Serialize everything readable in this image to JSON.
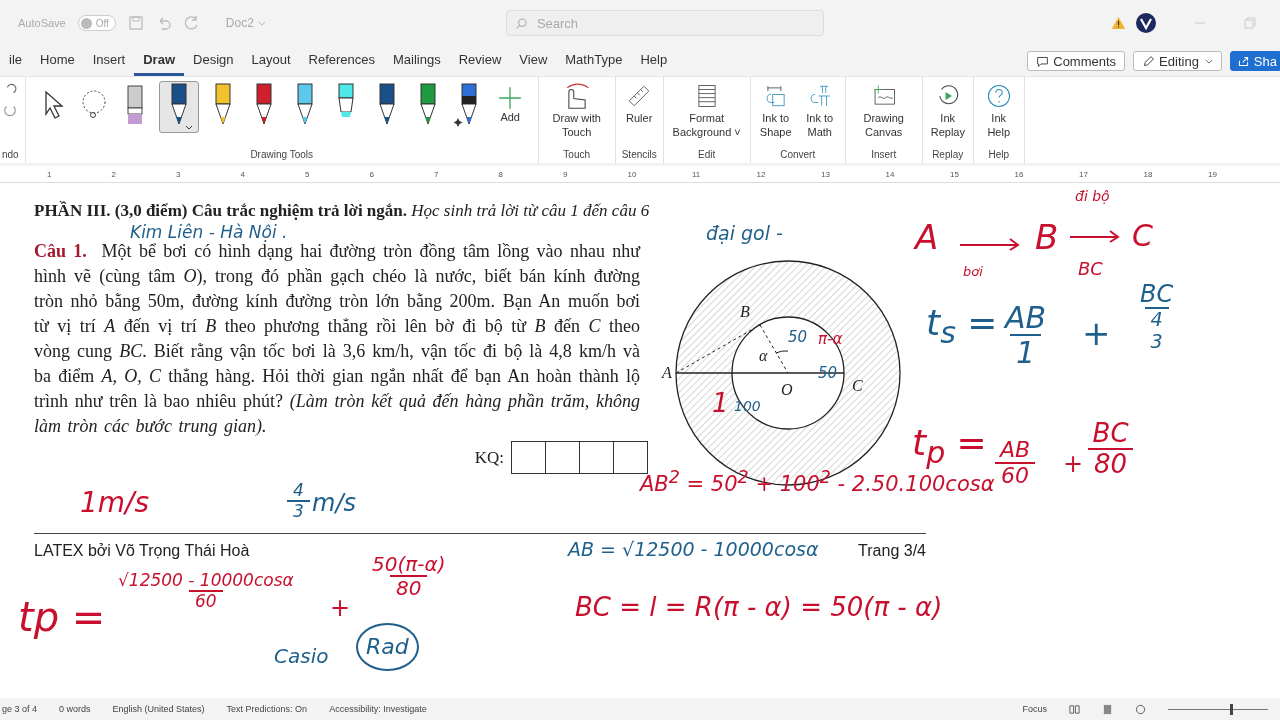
{
  "title_bar": {
    "autosave": "AutoSave",
    "autosave_toggle": {
      "label": "Off",
      "on": false
    },
    "document": "Doc2",
    "search": {
      "placeholder": "Search"
    }
  },
  "tabs": [
    {
      "label": "ile",
      "selected": false
    },
    {
      "label": "Home",
      "selected": false
    },
    {
      "label": "Insert",
      "selected": false
    },
    {
      "label": "Draw",
      "selected": true
    },
    {
      "label": "Design",
      "selected": false
    },
    {
      "label": "Layout",
      "selected": false
    },
    {
      "label": "References",
      "selected": false
    },
    {
      "label": "Mailings",
      "selected": false
    },
    {
      "label": "Review",
      "selected": false
    },
    {
      "label": "View",
      "selected": false
    },
    {
      "label": "MathType",
      "selected": false
    },
    {
      "label": "Help",
      "selected": false
    }
  ],
  "header_buttons": [
    {
      "kind": "comments",
      "label": "Comments"
    },
    {
      "kind": "editing",
      "label": "Editing"
    },
    {
      "kind": "share",
      "label": "Sha"
    }
  ],
  "ribbon": {
    "undo_group": "ndo",
    "tools": [
      {
        "kind": "select",
        "selected": false
      },
      {
        "kind": "lasso",
        "selected": false
      },
      {
        "kind": "eraser",
        "color": "#c39bd3",
        "selected": false
      },
      {
        "kind": "pen",
        "color": "#1b4f8a",
        "selected": true
      },
      {
        "kind": "pencil",
        "color": "#f2c12e",
        "selected": false
      },
      {
        "kind": "pen",
        "color": "#d0202e",
        "selected": false
      },
      {
        "kind": "pencil",
        "color": "#5bc8ec",
        "selected": false
      },
      {
        "kind": "highlighter",
        "color": "#4ee8e8",
        "selected": false
      },
      {
        "kind": "fountain",
        "color": "#1b4f8a",
        "selected": false
      },
      {
        "kind": "pen",
        "color": "#1e9b40",
        "selected": false
      },
      {
        "kind": "action",
        "color": "#2c6fd6",
        "selected": false
      }
    ],
    "add": "Add",
    "tools_group": "Drawing Tools",
    "groups": [
      {
        "label": "Touch",
        "buttons": [
          {
            "kind": "touch",
            "label": "Draw with Touch"
          }
        ]
      },
      {
        "label": "Stencils",
        "buttons": [
          {
            "kind": "ruler",
            "label": "Ruler"
          }
        ]
      },
      {
        "label": "Edit",
        "buttons": [
          {
            "kind": "background",
            "label": "Format Background ˅"
          }
        ]
      },
      {
        "label": "Convert",
        "buttons": [
          {
            "kind": "shape",
            "label": "Ink to Shape"
          },
          {
            "kind": "math",
            "label": "Ink to Math"
          }
        ]
      },
      {
        "label": "Insert",
        "buttons": [
          {
            "kind": "canvas",
            "label": "Drawing Canvas"
          }
        ]
      },
      {
        "label": "Replay",
        "buttons": [
          {
            "kind": "replay",
            "label": "Ink Replay"
          }
        ]
      },
      {
        "label": "Help",
        "buttons": [
          {
            "kind": "help",
            "label": "Ink Help"
          }
        ]
      }
    ]
  },
  "ruler": [
    "1",
    "2",
    "3",
    "4",
    "5",
    "6",
    "7",
    "8",
    "9",
    "10",
    "11",
    "12",
    "13",
    "14",
    "15",
    "16",
    "17",
    "18",
    "19"
  ],
  "document": {
    "heading": "**PHẦN III. (3,0 điểm) Câu trắc nghiệm trả lời ngắn.** *Học sinh trả lời từ câu 1 đến câu 6*",
    "question_label": "Câu 1.",
    "question": "Một bể bơi có hình dạng hai đường tròn đồng tâm lồng vào nhau như hình vẽ (cùng tâm *O*), trong đó phần gạch chéo là nước, biết bán kính đường tròn nhỏ bằng 50m, đường kính đường tròn lớn bằng 200m. Bạn An muốn bơi từ vị trí *A* đến vị trí *B* theo phương thẳng rồi lên bờ đi bộ từ *B* đến *C* theo vòng cung *BC*. Biết rằng vận tốc bơi là 3,6 km/h, vận tốc đi bộ là 4,8 km/h và ba điểm *A, O, C* thẳng hàng. Hỏi thời gian ngắn nhất để bạn An hoàn thành lộ trình như trên là bao nhiêu phút? *(Làm tròn kết quả đến hàng phần trăm, không làm tròn các bước trung gian).*",
    "answer_label": "KQ:",
    "figure_labels": [
      "B",
      "α",
      "A",
      "C",
      "O"
    ],
    "footer_left": "LATEX bởi Võ Trọng Thái Hoà",
    "footer_right": "Trang 3/4"
  },
  "ink": [
    {
      "kind": "text",
      "text": "Kim Liên - Hà Nội .",
      "color": "#1f5f8b"
    },
    {
      "kind": "text",
      "text": "đại gol -",
      "color": "#1f5f8b"
    },
    {
      "kind": "text",
      "text": "A",
      "color": "#c8102e"
    },
    {
      "kind": "text",
      "text": "B",
      "color": "#c8102e"
    },
    {
      "kind": "text",
      "text": "C",
      "color": "#c8102e"
    },
    {
      "kind": "text",
      "text": "bơi",
      "color": "#c8102e"
    },
    {
      "kind": "text",
      "text": "đi bộ",
      "color": "#c8102e"
    },
    {
      "kind": "text",
      "text": "BC",
      "color": "#c8102e"
    },
    {
      "kind": "text",
      "text": "t$_{s}$ =",
      "color": "#1f5f8b"
    },
    {
      "kind": "fraction",
      "num": "AB",
      "den": "1",
      "color": "#1f5f8b"
    },
    {
      "kind": "text",
      "text": "+",
      "color": "#1f5f8b"
    },
    {
      "kind": "fraction",
      "num": "BC",
      "den": {
        "num": "4",
        "den": "3"
      },
      "color": "#1f5f8b"
    },
    {
      "kind": "text",
      "text": "t$_{p}$ =",
      "color": "#c8102e"
    },
    {
      "kind": "fraction",
      "num": "AB",
      "den": "60",
      "color": "#c8102e"
    },
    {
      "kind": "text",
      "text": "+",
      "color": "#c8102e"
    },
    {
      "kind": "fraction",
      "num": "BC",
      "den": "80",
      "color": "#c8102e"
    },
    {
      "kind": "text",
      "text": "AB$^{2}$ = 50$^{2}$ + 100$^{2}$ - 2.50.100cosα",
      "color": "#c8102e"
    },
    {
      "kind": "text",
      "text": "1m/s",
      "color": "#c8102e"
    },
    {
      "kind": "fraction",
      "num": "4",
      "den": "3",
      "color": "#1f5f8b"
    },
    {
      "kind": "text",
      "text": "m/s",
      "color": "#1f5f8b"
    },
    {
      "kind": "text",
      "text": "50",
      "color": "#1f5f8b"
    },
    {
      "kind": "text",
      "text": "π-α",
      "color": "#c8102e"
    },
    {
      "kind": "text",
      "text": "50",
      "color": "#1f5f8b"
    },
    {
      "kind": "text",
      "text": "1",
      "color": "#c8102e"
    },
    {
      "kind": "text",
      "text": "100",
      "color": "#1f5f8b"
    },
    {
      "kind": "text",
      "text": "tp =",
      "color": "#c8102e"
    },
    {
      "kind": "fraction",
      "num": "√12500 - 10000cosα",
      "den": "60",
      "color": "#c8102e"
    },
    {
      "kind": "text",
      "text": "+",
      "color": "#c8102e"
    },
    {
      "kind": "fraction",
      "num": "50(π-α)",
      "den": "80",
      "color": "#c8102e"
    },
    {
      "kind": "text",
      "text": "Casio",
      "color": "#1f5f8b"
    },
    {
      "kind": "circled",
      "text": "Rad",
      "color": "#1f5f8b"
    },
    {
      "kind": "text",
      "text": "AB = √12500 - 10000cosα",
      "color": "#1f5f8b"
    },
    {
      "kind": "text",
      "text": "BC = l = R(π - α) = 50(π - α)",
      "color": "#c8102e"
    }
  ],
  "status_bar": {
    "items": [
      "ge 3 of 4",
      "0 words",
      "English (United States)",
      "Text Predictions: On",
      "Accessibility: Investigate"
    ],
    "focus": "Focus",
    "zoom": {
      "level": 0.62
    }
  }
}
